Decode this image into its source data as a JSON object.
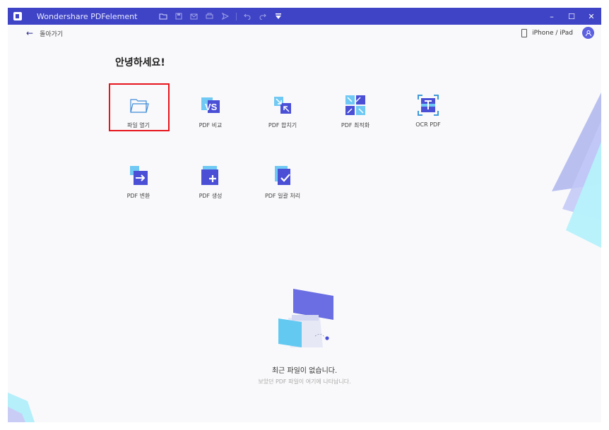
{
  "app": {
    "title": "Wondershare PDFelement"
  },
  "titlebar": {
    "tools": [
      "folder-icon",
      "save-icon",
      "mail-icon",
      "print-icon",
      "send-icon",
      "undo-icon",
      "redo-icon",
      "dropdown-icon"
    ],
    "controls": {
      "minimize": "–",
      "maximize": "☐",
      "close": "✕"
    }
  },
  "nav": {
    "back_label": "돌아가기",
    "device_label": "iPhone / iPad"
  },
  "home": {
    "greeting": "안녕하세요!",
    "tools": [
      {
        "label": "파일 열기",
        "icon": "folder-open-icon",
        "selected": true
      },
      {
        "label": "PDF 비교",
        "icon": "compare-icon"
      },
      {
        "label": "PDF 합치기",
        "icon": "merge-icon"
      },
      {
        "label": "PDF 최적화",
        "icon": "optimize-icon"
      },
      {
        "label": "OCR PDF",
        "icon": "ocr-icon"
      },
      {
        "label": "PDF 변환",
        "icon": "convert-icon"
      },
      {
        "label": "PDF 생성",
        "icon": "create-icon"
      },
      {
        "label": "PDF 일괄 처리",
        "icon": "batch-icon"
      }
    ],
    "empty_title": "최근 파일이 없습니다.",
    "empty_subtitle": "보았던 PDF 파일이 여기에 나타납니다."
  },
  "colors": {
    "brand": "#3f44c6",
    "accent": "#5b5fe0",
    "highlight": "#e6141b"
  }
}
